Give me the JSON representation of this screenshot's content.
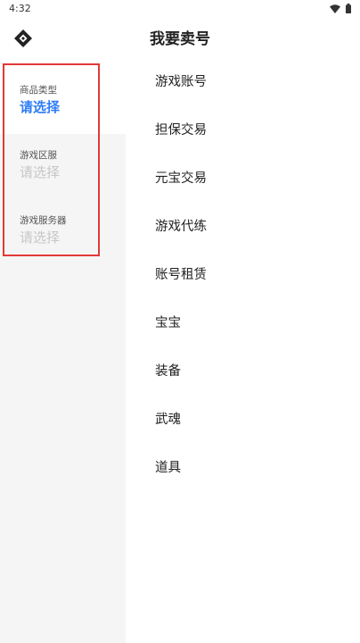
{
  "status_bar": {
    "time": "4:32"
  },
  "app_bar": {
    "title": "我要卖号",
    "back_icon": "diamond-back-icon"
  },
  "sidebar": {
    "filters": [
      {
        "label": "商品类型",
        "value": "请选择",
        "active": true
      },
      {
        "label": "游戏区服",
        "value": "请选择",
        "active": false
      },
      {
        "label": "游戏服务器",
        "value": "请选择",
        "active": false
      }
    ]
  },
  "categories": [
    "游戏账号",
    "担保交易",
    "元宝交易",
    "游戏代练",
    "账号租赁",
    "宝宝",
    "装备",
    "武魂",
    "道具"
  ],
  "colors": {
    "accent": "#2f7df6",
    "highlight_box": "#e33838",
    "sidebar_bg": "#f5f5f5",
    "placeholder": "#c6c6c6"
  }
}
